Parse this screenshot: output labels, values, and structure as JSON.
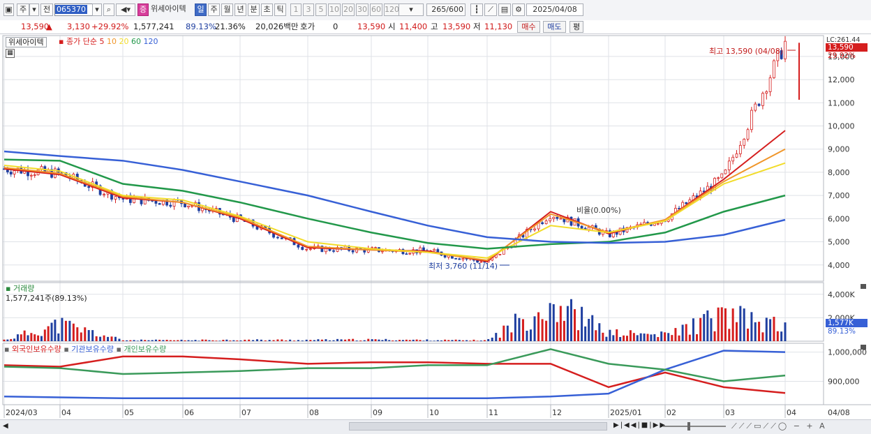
{
  "toolbar": {
    "market_label": "주",
    "prev_label": "전",
    "code_value": "065370",
    "badge_label": "증",
    "stock_name": "위세아이텍",
    "period_tabs": [
      "일",
      "주",
      "월",
      "년",
      "분",
      "초",
      "틱"
    ],
    "period_selected": "일",
    "interval_buttons": [
      "1",
      "3",
      "5",
      "10",
      "20",
      "30",
      "60",
      "120"
    ],
    "count_value": "265",
    "count_total": "/600",
    "date_value": "2025/04/08"
  },
  "quote": {
    "price": "13,590",
    "change": "3,130",
    "change_pct": "+29.92%",
    "volume": "1,577,241",
    "vol_ratio": "89.13%",
    "turnover": "21.36%",
    "amount": "20,026백만",
    "hoga_label": "호가",
    "hoga_value": "0",
    "hoga_price": "13,590",
    "open_label": "시",
    "open": "11,400",
    "high_label": "고",
    "high": "13,590",
    "low_label": "저",
    "low": "11,130",
    "buy_label": "매수",
    "sell_label": "매도",
    "avg_label": "평"
  },
  "price_panel": {
    "stock_label": "위세아이텍",
    "ma_title": "종가 단순",
    "ma_periods": [
      "5",
      "10",
      "20",
      "60",
      "120"
    ],
    "ma_colors": [
      "#d51e1e",
      "#f0962a",
      "#f2dc2a",
      "#22984a",
      "#3760d6"
    ],
    "high_annotation": "최고 13,590 (04/08)",
    "low_annotation": "최저 3,760 (11/14)",
    "mid_annotation": "비율(0.00%)",
    "right_top_label": "LC:261.44",
    "current_tag": "13,590",
    "pct_tag": "29.92%",
    "y_ticks": [
      "13,000",
      "12,000",
      "11,000",
      "10,000",
      "9,000",
      "8,000",
      "7,000",
      "6,000",
      "5,000",
      "4,000"
    ]
  },
  "volume_panel": {
    "title": "거래량",
    "value_text": "1,577,241주(89.13%)",
    "y_ticks": [
      "4,000K",
      "2,000K"
    ],
    "current_tag": "1,577K",
    "pct_tag": "89.13%"
  },
  "holding_panel": {
    "legend": [
      "외국인보유수량",
      "기관보유수량",
      "개인보유수량"
    ],
    "colors": [
      "#d51e1e",
      "#3760d6",
      "#3a9a5a"
    ],
    "y_ticks": [
      "1,000,000",
      "900,000"
    ]
  },
  "x_axis": [
    "2024/03",
    "04",
    "05",
    "06",
    "07",
    "08",
    "09",
    "10",
    "11",
    "12",
    "2025/01",
    "02",
    "03",
    "04"
  ],
  "x_axis_right": "04/08",
  "chart_data": [
    {
      "type": "line",
      "title": "위세아이텍 일봉 (종가 단순 이동평균 5/10/20/60/120)",
      "x": [
        "2024/03",
        "2024/04",
        "2024/05",
        "2024/06",
        "2024/07",
        "2024/08",
        "2024/09",
        "2024/10",
        "2024/11",
        "2024/12",
        "2025/01",
        "2025/02",
        "2025/03",
        "2025/04/08"
      ],
      "series": [
        {
          "name": "종가",
          "values": [
            8150,
            7950,
            6850,
            6700,
            5950,
            4700,
            4650,
            4600,
            4100,
            6200,
            5300,
            6000,
            7800,
            13590
          ]
        },
        {
          "name": "5",
          "values": [
            8150,
            7900,
            6900,
            6700,
            6000,
            4750,
            4650,
            4600,
            4150,
            6300,
            5350,
            5950,
            7700,
            9800
          ]
        },
        {
          "name": "10",
          "values": [
            8200,
            7950,
            6950,
            6700,
            6050,
            4800,
            4650,
            4550,
            4200,
            6200,
            5400,
            5950,
            7600,
            9000
          ]
        },
        {
          "name": "20",
          "values": [
            8300,
            8050,
            7000,
            6800,
            6100,
            5000,
            4700,
            4550,
            4300,
            5700,
            5400,
            5900,
            7500,
            8400
          ]
        },
        {
          "name": "60",
          "values": [
            8550,
            8500,
            7500,
            7200,
            6700,
            6000,
            5400,
            4950,
            4700,
            4900,
            5000,
            5400,
            6300,
            7000
          ]
        },
        {
          "name": "120",
          "values": [
            8900,
            8700,
            8500,
            8100,
            7600,
            7000,
            6300,
            5700,
            5200,
            5000,
            4950,
            5000,
            5300,
            5950
          ]
        }
      ],
      "ylim": [
        3300,
        13900
      ],
      "high": 13590,
      "low": 3760
    },
    {
      "type": "bar",
      "title": "거래량",
      "x": [
        "2024/03",
        "2024/04",
        "2024/05",
        "2024/06",
        "2024/07",
        "2024/08",
        "2024/09",
        "2024/10",
        "2024/11",
        "2024/12",
        "2025/01",
        "2025/02",
        "2025/03",
        "2025/04/08"
      ],
      "values_k": [
        150,
        1900,
        120,
        110,
        150,
        140,
        180,
        130,
        100,
        4500,
        900,
        700,
        2900,
        1577
      ],
      "ylim": [
        0,
        5000
      ]
    },
    {
      "type": "line",
      "title": "보유수량",
      "x": [
        "2024/03",
        "2024/04",
        "2024/05",
        "2024/06",
        "2024/07",
        "2024/08",
        "2024/09",
        "2024/10",
        "2024/11",
        "2024/12",
        "2025/01",
        "2025/02",
        "2025/03",
        "2025/04/08"
      ],
      "series": [
        {
          "name": "외국인보유수량",
          "values": [
            955000,
            950000,
            985000,
            985000,
            975000,
            960000,
            965000,
            965000,
            960000,
            960000,
            880000,
            930000,
            880000,
            860000
          ]
        },
        {
          "name": "기관보유수량",
          "values": [
            848000,
            845000,
            842000,
            842000,
            842000,
            842000,
            842000,
            842000,
            842000,
            848000,
            858000,
            940000,
            1005000,
            1000000
          ]
        },
        {
          "name": "개인보유수량",
          "values": [
            950000,
            945000,
            925000,
            930000,
            935000,
            945000,
            945000,
            955000,
            955000,
            1010000,
            960000,
            940000,
            900000,
            920000
          ]
        }
      ],
      "ylim": [
        820000,
        1030000
      ]
    }
  ]
}
